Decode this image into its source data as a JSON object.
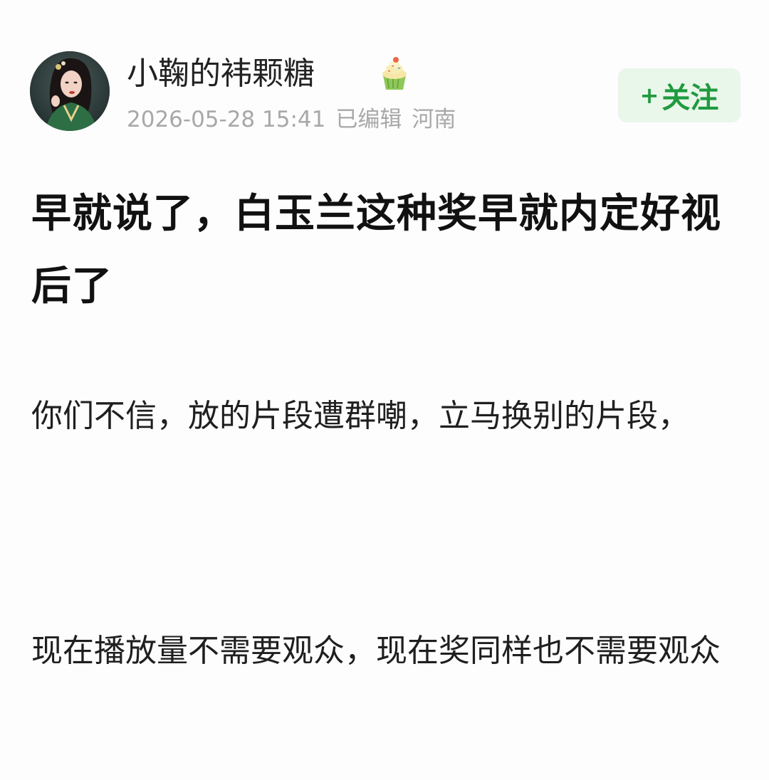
{
  "post": {
    "author": {
      "name": "小鞠的袆颗糖",
      "badge_icon": "cupcake-icon"
    },
    "meta": {
      "timestamp": "2026-05-28 15:41",
      "edited": "已编辑",
      "location": "河南"
    },
    "follow_button": {
      "plus": "+",
      "label": "关注"
    },
    "title": "早就说了，白玉兰这种奖早就内定好视后了",
    "paragraphs": [
      "你们不信，放的片段遭群嘲，立马换别的片段，",
      "现在播放量不需要观众，现在奖同样也不需要观众"
    ]
  },
  "colors": {
    "accent_green": "#1f9a3f",
    "follow_bg": "#e9f6ea",
    "meta_gray": "#a8a8a8",
    "text_dark": "#111111"
  }
}
